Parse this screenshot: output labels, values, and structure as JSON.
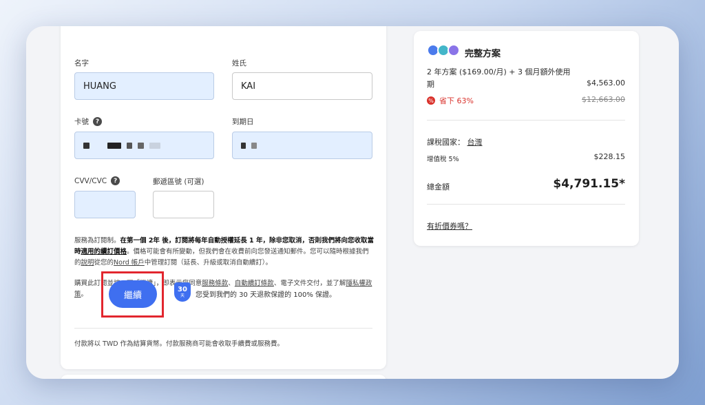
{
  "form": {
    "first_name_label": "名字",
    "first_name_value": "HUANG",
    "last_name_label": "姓氏",
    "last_name_value": "KAI",
    "card_label": "卡號",
    "expiry_label": "到期日",
    "cvv_label": "CVV/CVC",
    "postal_label": "郵遞區號 (可選)",
    "terms_1a": "服務為訂閱制。",
    "terms_1b": "在第一個 2年 後，訂閱將每年自動授權延長 1 年，除非您取消，否則我們將向您收取當時",
    "terms_1c": "適用的續訂價格",
    "terms_1d": "。價格可能會有所變動，但我們會在收費前向您發送通知郵件。您可以隨時根據我們的",
    "terms_1e": "說明",
    "terms_1f": "從您的",
    "terms_1g": "Nord 帳戶",
    "terms_1h": "中管理訂閱（延長、升級或取消自動續訂）。",
    "terms_2a": "購買此訂閱並按一下「繼續」，即表示您同意",
    "terms_2b": "服務條款",
    "terms_2c": "、",
    "terms_2d": "自動續訂條款",
    "terms_2e": "、電子文件交付，並了解",
    "terms_2f": "隱私權政策",
    "terms_2g": "。",
    "continue_label": "繼續",
    "shield_number": "30",
    "shield_unit": "天",
    "guarantee_text": "您受到我們的 30 天退款保證的 100% 保證。",
    "footnote": "付款將以 TWD 作為結算貨幣。付款服務商可能會收取手續費或服務費。"
  },
  "summary": {
    "plan_title": "完整方案",
    "plan_desc_1": "2 年方案 ($169.00/月) + 3 個月額外使用",
    "plan_desc_2": "期",
    "plan_price": "$4,563.00",
    "save_label": "省下 63%",
    "original_price": "$12,663.00",
    "tax_country_label": "課稅國家：",
    "tax_country": "台灣",
    "vat_label": "增值稅 5%",
    "vat_amount": "$228.15",
    "total_label": "總金額",
    "total_amount": "$4,791.15*",
    "coupon_link": "有折價券嗎？"
  },
  "colors": {
    "accent": "#3f6ff0",
    "highlight_border": "#e2262e",
    "discount": "#d9312b"
  }
}
